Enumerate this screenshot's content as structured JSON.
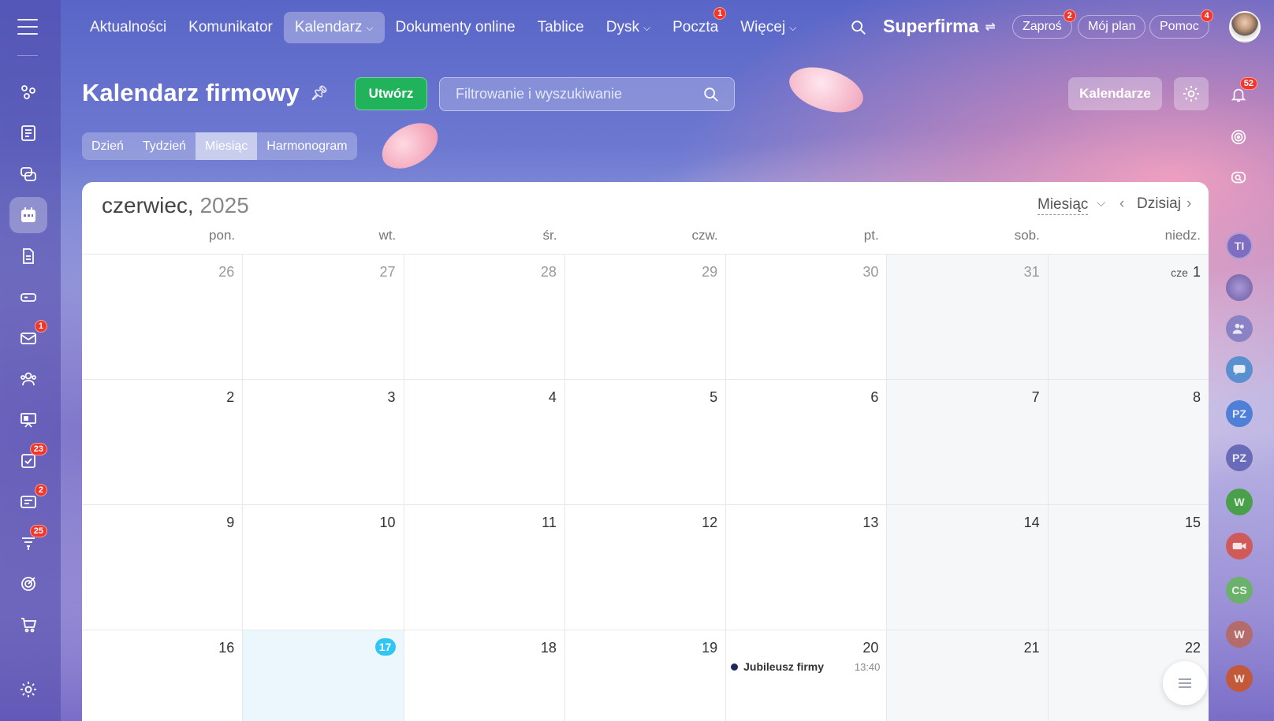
{
  "topnav": {
    "items": [
      {
        "label": "Aktualności"
      },
      {
        "label": "Komunikator"
      },
      {
        "label": "Kalendarz",
        "chev": "⌵"
      },
      {
        "label": "Dokumenty online"
      },
      {
        "label": "Tablice"
      },
      {
        "label": "Dysk",
        "chev": "⌵"
      },
      {
        "label": "Poczta",
        "badge": "1"
      },
      {
        "label": "Więcej",
        "chev": "⌵"
      }
    ],
    "brand": "Superfirma",
    "invite": {
      "label": "Zaproś",
      "badge": "2"
    },
    "my_plan": "Mój plan",
    "help": {
      "label": "Pomoc",
      "badge": "4"
    }
  },
  "left_sidebar": {
    "mail_badge": "1",
    "tasks_badge": "23",
    "crm_badge": "2",
    "feed_badge": "25"
  },
  "header": {
    "title": "Kalendarz firmowy",
    "create_label": "Utwórz",
    "search_placeholder": "Filtrowanie i wyszukiwanie",
    "calendars_label": "Kalendarze",
    "view_tabs": [
      {
        "label": "Dzień"
      },
      {
        "label": "Tydzień"
      },
      {
        "label": "Miesiąc"
      },
      {
        "label": "Harmonogram"
      }
    ]
  },
  "right_sidebar": {
    "notifications_badge": "52",
    "avatars": [
      "TI",
      "PZ",
      "PZ",
      "W",
      "CS",
      "W",
      "W"
    ]
  },
  "calendar": {
    "month": "czerwiec,",
    "year": "2025",
    "view_select": "Miesiąc",
    "today_label": "Dzisiaj",
    "weekdays": [
      "pon.",
      "wt.",
      "śr.",
      "czw.",
      "pt.",
      "sob.",
      "niedz."
    ],
    "weeks": [
      [
        "26",
        "27",
        "28",
        "29",
        "30",
        "31",
        "1"
      ],
      [
        "2",
        "3",
        "4",
        "5",
        "6",
        "7",
        "8"
      ],
      [
        "9",
        "10",
        "11",
        "12",
        "13",
        "14",
        "15"
      ],
      [
        "16",
        "17",
        "18",
        "19",
        "20",
        "21",
        "22"
      ]
    ],
    "first_month_prefix": "cze",
    "event": {
      "title": "Jubileusz firmy",
      "time": "13:40"
    }
  },
  "colors": {
    "create_button": "#21b35b",
    "today_badge": "#2fc6f6",
    "notification_badge": "#f0372c",
    "event_dot": "#1b2a5a"
  }
}
